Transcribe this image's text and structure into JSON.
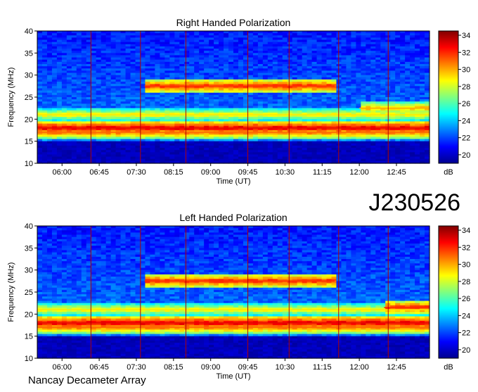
{
  "observation_id": "J230526",
  "footer": "Nancay Decameter Array",
  "colorbar": {
    "unit": "dB",
    "ticks": [
      "34",
      "32",
      "30",
      "28",
      "26",
      "24",
      "22",
      "20"
    ],
    "range": [
      19,
      34.5
    ],
    "colormap": "jet"
  },
  "chart_data": [
    {
      "type": "heatmap",
      "title": "Right Handed Polarization",
      "xlabel": "Time (UT)",
      "ylabel": "Frequency (MHz)",
      "x_ticks": [
        "06:00",
        "06:45",
        "07:30",
        "08:15",
        "09:00",
        "09:45",
        "10:30",
        "11:15",
        "12:00",
        "12:45"
      ],
      "y_ticks": [
        "40",
        "35",
        "30",
        "25",
        "20",
        "15",
        "10"
      ],
      "ylim": [
        10,
        40
      ],
      "xlim": [
        "05:30",
        "13:25"
      ],
      "marker_times": [
        "06:35",
        "07:35",
        "08:30",
        "09:45",
        "10:35",
        "11:35",
        "12:35"
      ],
      "bands": [
        {
          "freq": 18.0,
          "level": 33,
          "from": "05:30",
          "to": "13:25"
        },
        {
          "freq": 17.0,
          "level": 31,
          "from": "05:30",
          "to": "13:25"
        },
        {
          "freq": 21.0,
          "level": 29,
          "from": "05:30",
          "to": "13:25"
        },
        {
          "freq": 27.5,
          "level": 32,
          "from": "07:40",
          "to": "11:30"
        },
        {
          "freq": 22.5,
          "level": 30,
          "from": "12:00",
          "to": "13:25"
        }
      ]
    },
    {
      "type": "heatmap",
      "title": "Left Handed Polarization",
      "xlabel": "Time (UT)",
      "ylabel": "Frequency (MHz)",
      "x_ticks": [
        "06:00",
        "06:45",
        "07:30",
        "08:15",
        "09:00",
        "09:45",
        "10:30",
        "11:15",
        "12:00",
        "12:45"
      ],
      "y_ticks": [
        "40",
        "35",
        "30",
        "25",
        "20",
        "15",
        "10"
      ],
      "ylim": [
        10,
        40
      ],
      "xlim": [
        "05:30",
        "13:25"
      ],
      "marker_times": [
        "06:35",
        "07:35",
        "08:30",
        "09:45",
        "10:35",
        "11:35",
        "12:35"
      ],
      "bands": [
        {
          "freq": 18.0,
          "level": 33,
          "from": "05:30",
          "to": "13:25"
        },
        {
          "freq": 17.0,
          "level": 31,
          "from": "05:30",
          "to": "13:25"
        },
        {
          "freq": 21.0,
          "level": 29,
          "from": "05:30",
          "to": "13:25"
        },
        {
          "freq": 27.5,
          "level": 32,
          "from": "07:40",
          "to": "11:30"
        },
        {
          "freq": 21.5,
          "level": 32,
          "from": "12:30",
          "to": "13:25"
        }
      ]
    }
  ]
}
